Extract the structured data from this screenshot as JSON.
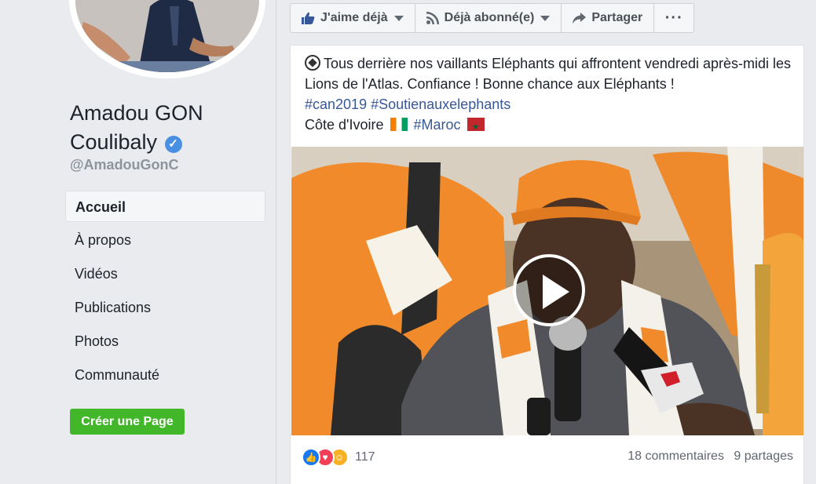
{
  "profile": {
    "name_line1": "Amadou GON",
    "name_line2": "Coulibaly",
    "handle": "@AmadouGonC"
  },
  "nav": {
    "items": [
      {
        "label": "Accueil",
        "active": true
      },
      {
        "label": "À propos"
      },
      {
        "label": "Vidéos"
      },
      {
        "label": "Publications"
      },
      {
        "label": "Photos"
      },
      {
        "label": "Communauté"
      }
    ]
  },
  "create_page_label": "Créer une Page",
  "actions": {
    "like_label": "J'aime déjà",
    "follow_label": "Déjà abonné(e)",
    "share_label": "Partager",
    "more_label": "···"
  },
  "post": {
    "text_line1": "Tous derrière nos vaillants Eléphants qui affrontent vendredi après-midi les Lions de l'Atlas. Confiance ! Bonne chance aux Eléphants !",
    "hashtag1": "#can2019",
    "hashtag2": "#Soutienauxelephants",
    "country1": "Côte d'Ivoire",
    "hashtag3": "#Maroc",
    "reaction_count": "117",
    "comments": "18 commentaires",
    "shares": "9 partages"
  },
  "colors": {
    "link": "#385898",
    "create_button": "#42b72a",
    "verified": "#4a90e2"
  }
}
